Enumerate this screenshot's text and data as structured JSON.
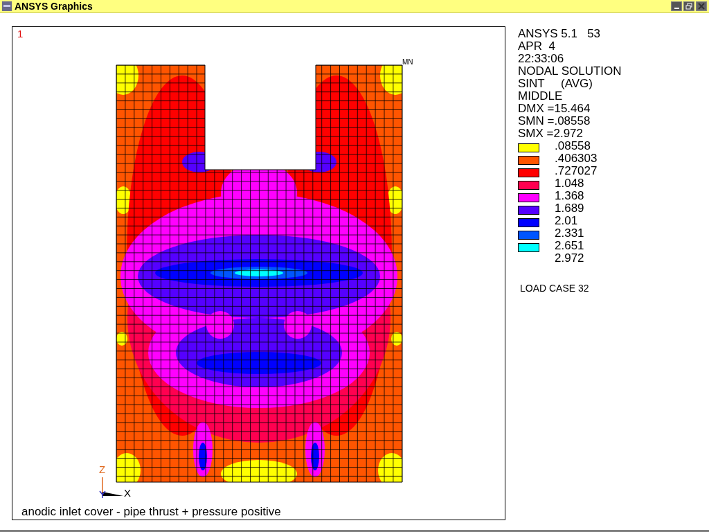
{
  "window": {
    "title": "ANSYS Graphics"
  },
  "plot": {
    "window_number": "1",
    "min_marker": "MN",
    "axis_labels": [
      "Z",
      "X"
    ],
    "caption": "anodic inlet cover - pipe thrust + pressure positive"
  },
  "info": [
    "ANSYS 5.1   53",
    "APR  4",
    "22:33:06",
    "NODAL SOLUTION",
    "SINT     (AVG)",
    "MIDDLE",
    "DMX =15.464",
    "SMN =.08558",
    "SMX =2.972"
  ],
  "legend": {
    "bands": [
      {
        "color": "#ffff00",
        "label": ".08558"
      },
      {
        "color": "#ff5500",
        "label": ".406303"
      },
      {
        "color": "#ff0000",
        "label": ".727027"
      },
      {
        "color": "#ff0050",
        "label": "1.048"
      },
      {
        "color": "#ff00ff",
        "label": "1.368"
      },
      {
        "color": "#5500ff",
        "label": "1.689"
      },
      {
        "color": "#0000ff",
        "label": "2.01"
      },
      {
        "color": "#0055ff",
        "label": "2.331"
      },
      {
        "color": "#00ffff",
        "label": "2.651"
      }
    ],
    "max_label": "2.972"
  },
  "load_case": "LOAD CASE 32"
}
